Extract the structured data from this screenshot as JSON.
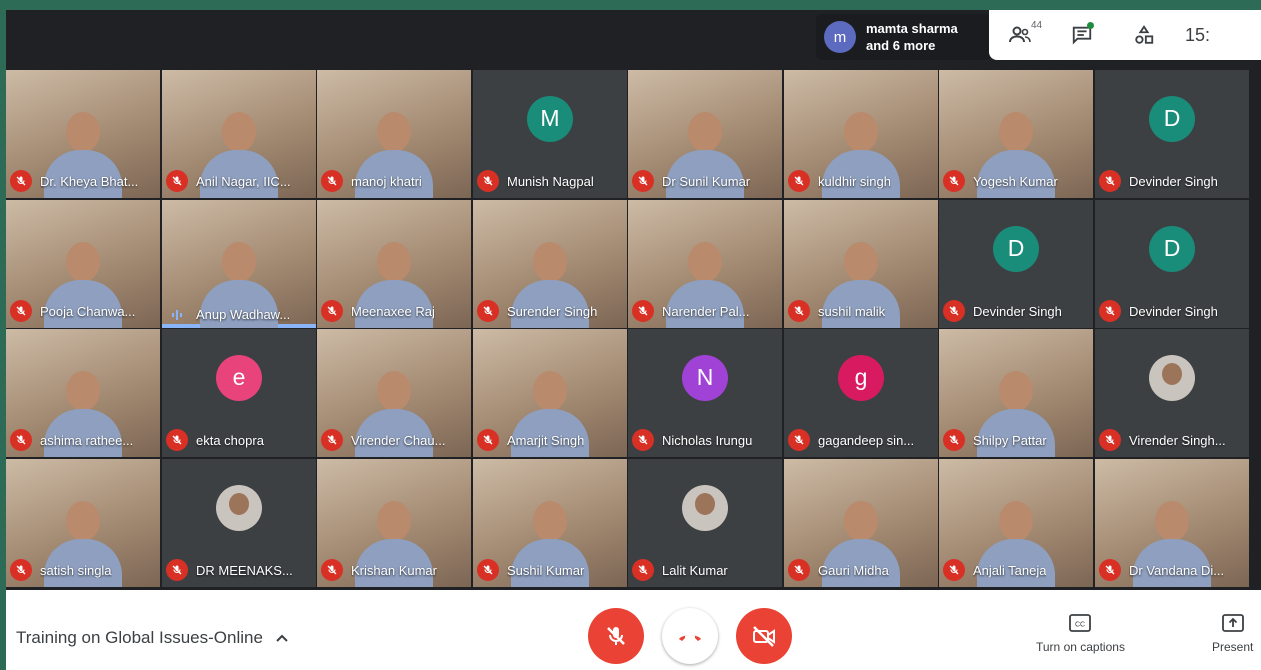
{
  "notification": {
    "avatar_letter": "m",
    "line1": "mamta sharma",
    "line2": "and 6 more"
  },
  "toolbar": {
    "participants_count": "44",
    "clock": "15:"
  },
  "tiles": [
    {
      "name": "Dr. Kheya Bhat...",
      "kind": "video",
      "muted": true
    },
    {
      "name": "Anil Nagar, IIC...",
      "kind": "video",
      "muted": true
    },
    {
      "name": "manoj khatri",
      "kind": "video",
      "muted": true
    },
    {
      "name": "Munish Nagpal",
      "kind": "letter",
      "letter": "M",
      "color": "#1a8c7a",
      "muted": true
    },
    {
      "name": "Dr Sunil Kumar",
      "kind": "video",
      "muted": true
    },
    {
      "name": "kuldhir singh",
      "kind": "video",
      "muted": true
    },
    {
      "name": "Yogesh Kumar",
      "kind": "video",
      "muted": true
    },
    {
      "name": "Devinder Singh",
      "kind": "letter",
      "letter": "D",
      "color": "#1a8c7a",
      "muted": true
    },
    {
      "name": "Pooja Chanwa...",
      "kind": "video",
      "muted": true
    },
    {
      "name": "Anup Wadhaw...",
      "kind": "video",
      "muted": false
    },
    {
      "name": "Meenaxee Raj",
      "kind": "video",
      "muted": true
    },
    {
      "name": "Surender Singh",
      "kind": "video",
      "muted": true
    },
    {
      "name": "Narender Pal...",
      "kind": "video",
      "muted": true
    },
    {
      "name": "sushil malik",
      "kind": "video",
      "muted": true
    },
    {
      "name": "Devinder Singh",
      "kind": "letter",
      "letter": "D",
      "color": "#1a8c7a",
      "muted": true
    },
    {
      "name": "Devinder Singh",
      "kind": "letter",
      "letter": "D",
      "color": "#1a8c7a",
      "muted": true
    },
    {
      "name": "ashima rathee...",
      "kind": "video",
      "muted": true
    },
    {
      "name": "ekta chopra",
      "kind": "letter",
      "letter": "e",
      "color": "#e8437b",
      "muted": true
    },
    {
      "name": "Virender Chau...",
      "kind": "video",
      "muted": true
    },
    {
      "name": "Amarjit Singh",
      "kind": "video",
      "muted": true
    },
    {
      "name": "Nicholas Irungu",
      "kind": "letter",
      "letter": "N",
      "color": "#a142d6",
      "muted": true
    },
    {
      "name": "gagandeep sin...",
      "kind": "letter",
      "letter": "g",
      "color": "#d81b60",
      "muted": true
    },
    {
      "name": "Shilpy Pattar",
      "kind": "video",
      "muted": true
    },
    {
      "name": "Virender Singh...",
      "kind": "photo",
      "muted": true
    },
    {
      "name": "satish singla",
      "kind": "video",
      "muted": true
    },
    {
      "name": "DR MEENAKS...",
      "kind": "photo",
      "muted": true
    },
    {
      "name": "Krishan Kumar",
      "kind": "video",
      "muted": true
    },
    {
      "name": "Sushil Kumar",
      "kind": "video",
      "muted": true
    },
    {
      "name": "Lalit Kumar",
      "kind": "photo",
      "muted": true
    },
    {
      "name": "Gauri Midha",
      "kind": "video",
      "muted": true
    },
    {
      "name": "Anjali Taneja",
      "kind": "video",
      "muted": true
    },
    {
      "name": "Dr Vandana Di...",
      "kind": "video",
      "muted": true
    }
  ],
  "bottom": {
    "meeting_title": "Training on Global Issues-Online",
    "captions_label": "Turn on captions",
    "present_label": "Present"
  }
}
